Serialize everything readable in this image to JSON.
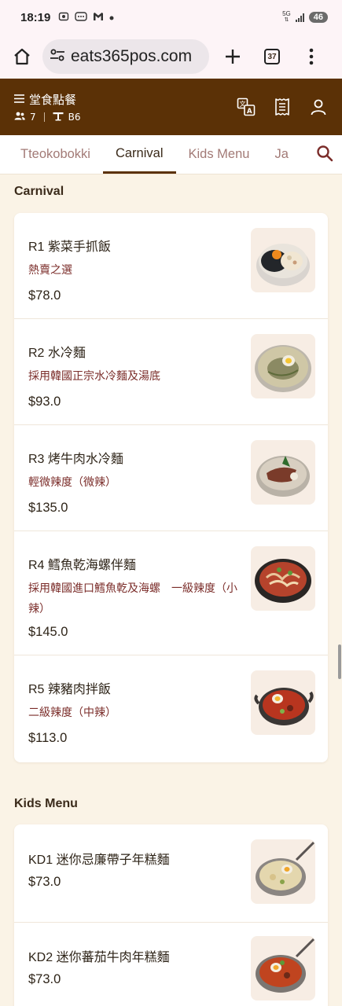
{
  "status_bar": {
    "time": "18:19",
    "network": "5G",
    "battery": "46"
  },
  "browser": {
    "url": "eats365pos.com",
    "tab_count": "37"
  },
  "header": {
    "order_type": "堂食點餐",
    "guests": "7",
    "table": "B6"
  },
  "tabs": [
    "Tteokobokki",
    "Carnival",
    "Kids Menu",
    "Ja"
  ],
  "active_tab": "Carnival",
  "sections": [
    {
      "title": "Carnival",
      "items": [
        {
          "name": "R1 紫菜手抓飯",
          "desc": "熱賣之選",
          "price": "$78.0"
        },
        {
          "name": "R2 水冷麵",
          "desc": "採用韓國正宗水冷麵及湯底",
          "price": "$93.0"
        },
        {
          "name": "R3 烤牛肉水冷麵",
          "desc": "輕微辣度（微辣）",
          "price": "$135.0"
        },
        {
          "name": "R4 鱈魚乾海螺伴麵",
          "desc": "採用韓國進口鱈魚乾及海螺　一級辣度（小辣）",
          "price": "$145.0"
        },
        {
          "name": "R5 辣豬肉拌飯",
          "desc": "二級辣度（中辣）",
          "price": "$113.0"
        }
      ]
    },
    {
      "title": "Kids Menu",
      "items": [
        {
          "name": "KD1 迷你忌廉帶子年糕麵",
          "desc": "",
          "price": "$73.0"
        },
        {
          "name": "KD2 迷你蕃茄牛肉年糕麵",
          "desc": "",
          "price": "$73.0"
        }
      ]
    }
  ],
  "colors": {
    "header_bg": "#5b3106",
    "page_bg": "#faf3e6",
    "desc_text": "#7b2d2a",
    "inactive_tab": "#a27a76"
  }
}
